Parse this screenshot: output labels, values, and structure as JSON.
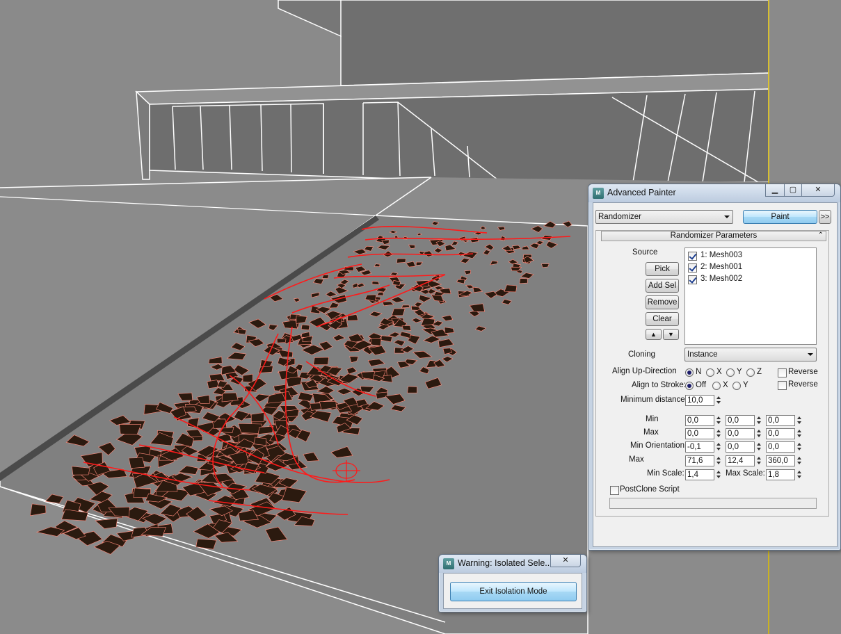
{
  "colors": {
    "viewport_background": "#8a8a8a",
    "wireframe": "#ffffff",
    "scatter_pieces": "#2b1a0f",
    "spline_selected": "#ff0000",
    "dialog_frame": "#c6d3e3"
  },
  "painter": {
    "title": "Advanced Painter",
    "icon": "3ds-max-icon",
    "mode_value": "Randomizer",
    "paint_label": "Paint",
    "expand_label": ">>",
    "rollout_title": "Randomizer Parameters",
    "source_label": "Source",
    "pick_label": "Pick",
    "add_sel_label": "Add Sel",
    "remove_label": "Remove",
    "clear_label": "Clear",
    "sources": [
      {
        "label": "1: Mesh003",
        "checked": true
      },
      {
        "label": "2: Mesh001",
        "checked": true
      },
      {
        "label": "3: Mesh002",
        "checked": true
      }
    ],
    "cloning_label": "Cloning",
    "cloning_value": "Instance",
    "align_up_label": "Align Up-Direction",
    "align_up_options": [
      "N",
      "X",
      "Y",
      "Z"
    ],
    "align_up_selected": "N",
    "reverse_label": "Reverse",
    "align_stroke_label": "Align to Stroke:",
    "align_stroke_options": [
      "Off",
      "X",
      "Y"
    ],
    "align_stroke_selected": "Off",
    "min_distance_label": "Minimum distance:",
    "min_distance_value": "10,0",
    "min_label": "Min",
    "min_values": [
      "0,0",
      "0,0",
      "0,0"
    ],
    "max_label": "Max",
    "max_values": [
      "0,0",
      "0,0",
      "0,0"
    ],
    "min_orientation_label": "Min Orientation:",
    "min_orientation_values": [
      "-0,1",
      "0,0",
      "0,0"
    ],
    "max_orientation_label": "Max",
    "max_orientation_values": [
      "71,6",
      "12,4",
      "360,0"
    ],
    "min_scale_label": "Min Scale:",
    "min_scale_value": "1,4",
    "max_scale_label": "Max Scale:",
    "max_scale_value": "1,8",
    "postclone_label": "PostClone Script",
    "postclone_checked": false,
    "postclone_value": ""
  },
  "warning": {
    "title": "Warning: Isolated Sele...",
    "icon": "3ds-max-icon",
    "exit_label": "Exit Isolation Mode"
  }
}
